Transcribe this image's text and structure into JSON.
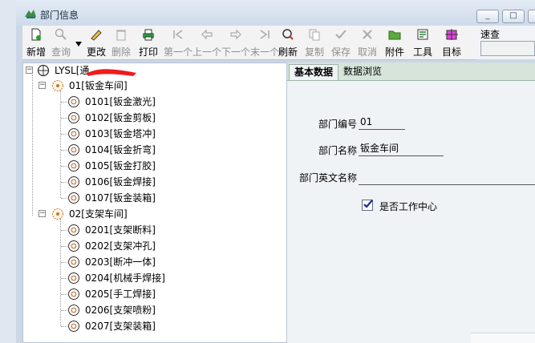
{
  "window": {
    "title": "部门信息",
    "controls": [
      "_",
      "□",
      "✕"
    ]
  },
  "toolbar": {
    "buttons": [
      {
        "label": "新增",
        "enabled": true
      },
      {
        "label": "查询",
        "enabled": false
      },
      {
        "label": "更改",
        "enabled": true
      },
      {
        "label": "删除",
        "enabled": false
      },
      {
        "label": "打印",
        "enabled": true
      },
      {
        "label": "第一个",
        "enabled": false
      },
      {
        "label": "上一个",
        "enabled": false
      },
      {
        "label": "下一个",
        "enabled": false
      },
      {
        "label": "末一个",
        "enabled": false
      },
      {
        "label": "刷新",
        "enabled": true
      },
      {
        "label": "复制",
        "enabled": false
      },
      {
        "label": "保存",
        "enabled": false
      },
      {
        "label": "取消",
        "enabled": false
      },
      {
        "label": "附件",
        "enabled": true
      },
      {
        "label": "工具",
        "enabled": true
      },
      {
        "label": "目标",
        "enabled": true
      }
    ]
  },
  "quick_search": {
    "label": "速查",
    "value": ""
  },
  "tree": {
    "root": "LYSL[通",
    "groups": [
      {
        "label": "01[钣金车间]",
        "children": [
          "0101[钣金激光]",
          "0102[钣金剪板]",
          "0103[钣金塔冲]",
          "0104[钣金折弯]",
          "0105[钣金打胶]",
          "0106[钣金焊接]",
          "0107[钣金装箱]"
        ]
      },
      {
        "label": "02[支架车间]",
        "children": [
          "0201[支架断料]",
          "0202[支架冲孔]",
          "0203[断冲一体]",
          "0204[机械手焊接]",
          "0205[手工焊接]",
          "0206[支架喷粉]",
          "0207[支架装箱]"
        ]
      }
    ]
  },
  "tabs": [
    "基本数据",
    "数据浏览"
  ],
  "form": {
    "dept_code_label": "部门编号",
    "dept_code_value": "01",
    "dept_name_label": "部门名称",
    "dept_name_value": "钣金车间",
    "dept_en_label": "部门英文名称",
    "dept_en_value": "",
    "work_center_label": "是否工作中心",
    "work_center_checked": true
  },
  "colors": {
    "accent_red": "#e02020",
    "tab_bg": "#d6e4da"
  }
}
